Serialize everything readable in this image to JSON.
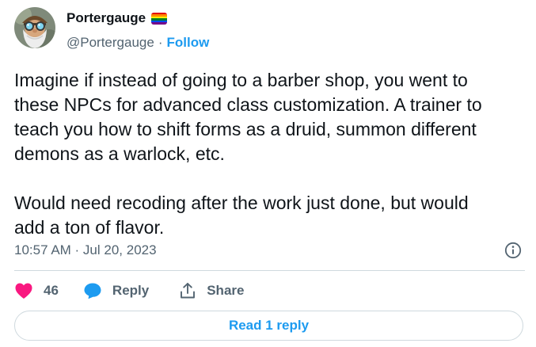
{
  "author": {
    "display_name": "Portergauge",
    "handle": "@Portergauge",
    "separator": "·",
    "follow_label": "Follow",
    "avatar_icon": "bearded-gnome-avatar",
    "badge_icon": "rainbow-flag-icon"
  },
  "tweet": {
    "text": "Imagine if instead of going to a barber shop, you went to\nthese NPCs for advanced class customization. A trainer to\nteach you how to shift forms as a druid, summon different\ndemons as a warlock, etc.\n\nWould need recoding after the work just done, but would\nadd a ton of flavor.",
    "timestamp": "10:57 AM · Jul 20, 2023"
  },
  "actions": {
    "like_count": "46",
    "reply_label": "Reply",
    "share_label": "Share"
  },
  "footer": {
    "read_replies_label": "Read 1 reply"
  },
  "colors": {
    "accent": "#1d9bf0",
    "like": "#f91880",
    "muted": "#536471",
    "border": "#cfd9de"
  }
}
